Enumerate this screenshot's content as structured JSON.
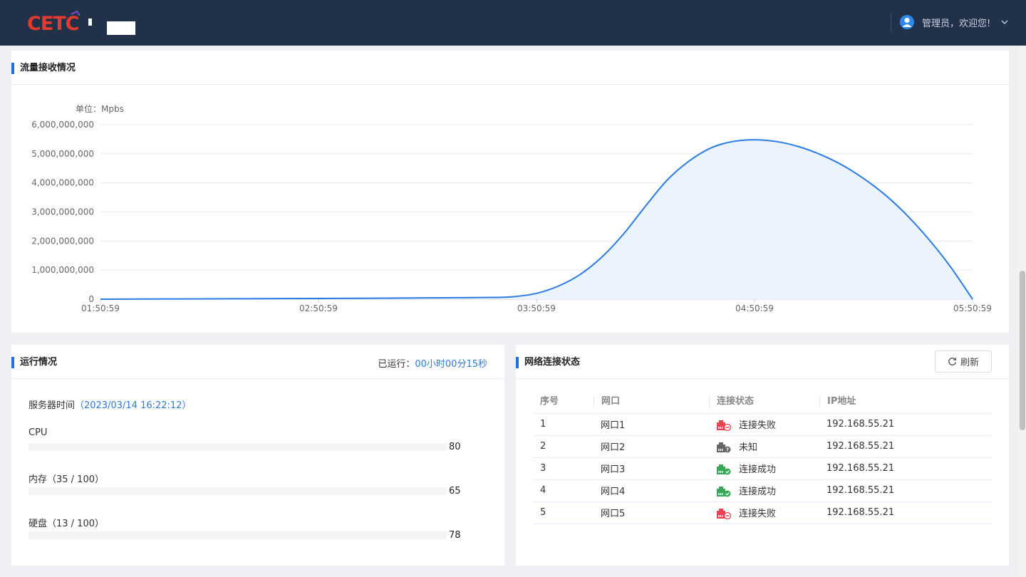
{
  "header": {
    "logo_text": "CETC",
    "user_greeting": "管理员，欢迎您!"
  },
  "traffic": {
    "title": "流量接收情况"
  },
  "chart_data": {
    "type": "area",
    "title": "",
    "unit_label": "单位：Mpbs",
    "ylabel": "",
    "xlabel": "",
    "ylim": [
      0,
      6000000000
    ],
    "yticks": [
      0,
      1000000000,
      2000000000,
      3000000000,
      4000000000,
      5000000000,
      6000000000
    ],
    "ytick_labels": [
      "0",
      "1,000,000,000",
      "2,000,000,000",
      "3,000,000,000",
      "4,000,000,000",
      "5,000,000,000",
      "6,000,000,000"
    ],
    "xtick_labels": [
      "01:50:59",
      "02:50:59",
      "03:50:59",
      "04:50:59",
      "05:50:59"
    ],
    "x": [
      0,
      20,
      40,
      60,
      80,
      100,
      120,
      140,
      160,
      180,
      190,
      200,
      210,
      220,
      230,
      240,
      250,
      260,
      270,
      280,
      290,
      300,
      310,
      320,
      330,
      340,
      350,
      360,
      370,
      380,
      390,
      400
    ],
    "values": [
      0,
      5000000,
      10000000,
      15000000,
      20000000,
      25000000,
      30000000,
      40000000,
      50000000,
      60000000,
      90000000,
      200000000,
      450000000,
      850000000,
      1450000000,
      2250000000,
      3200000000,
      4100000000,
      4750000000,
      5200000000,
      5420000000,
      5480000000,
      5420000000,
      5250000000,
      4980000000,
      4620000000,
      4150000000,
      3580000000,
      2880000000,
      2050000000,
      1100000000,
      0
    ],
    "grid": true,
    "colors": {
      "line": "#2a7be4",
      "fill": "#ebf3fd"
    }
  },
  "run": {
    "title": "运行情况",
    "uptime_label": "已运行：",
    "uptime_value": "00小时00分15秒",
    "server_time_label": "服务器时间",
    "server_time_value": "（2023/03/14 16:22:12）",
    "metrics": [
      {
        "label": "CPU",
        "value": "80",
        "percent": 80
      },
      {
        "label": "内存（35 / 100）",
        "value": "65",
        "percent": 65
      },
      {
        "label": "硬盘（13 / 100）",
        "value": "78",
        "percent": 78
      }
    ]
  },
  "net": {
    "title": "网络连接状态",
    "refresh_label": "刷新",
    "columns": [
      "序号",
      "网口",
      "连接状态",
      "IP地址"
    ],
    "rows": [
      {
        "index": "1",
        "port": "网口1",
        "status": "连接失败",
        "state": "fail",
        "ip": "192.168.55.21"
      },
      {
        "index": "2",
        "port": "网口2",
        "status": "未知",
        "state": "unknown",
        "ip": "192.168.55.21"
      },
      {
        "index": "3",
        "port": "网口3",
        "status": "连接成功",
        "state": "ok",
        "ip": "192.168.55.21"
      },
      {
        "index": "4",
        "port": "网口4",
        "status": "连接成功",
        "state": "ok",
        "ip": "192.168.55.21"
      },
      {
        "index": "5",
        "port": "网口5",
        "status": "连接失败",
        "state": "fail",
        "ip": "192.168.55.21"
      }
    ],
    "state_colors": {
      "fail": "#e8434f",
      "unknown": "#666666",
      "ok": "#3aa757"
    }
  }
}
